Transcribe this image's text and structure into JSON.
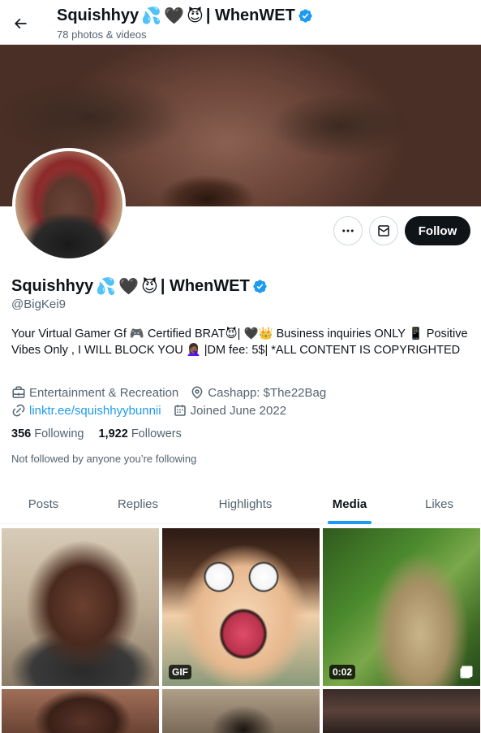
{
  "header": {
    "back_icon": "arrow-left-icon",
    "name_text": "Squishhyy",
    "name_suffix": "| WhenWET",
    "emojis": [
      "💦",
      "🖤",
      "😈"
    ],
    "subtitle": "78 photos & videos"
  },
  "profile": {
    "name_text": "Squishhyy",
    "name_suffix": "| WhenWET",
    "emojis": [
      "💦",
      "🖤",
      "😈"
    ],
    "verified_icon": "verified-badge-icon",
    "handle": "@BigKei9",
    "bio": "Your Virtual Gamer Gf 🎮 Certified BRAT😈| 🖤👑 Business inquiries ONLY 📱 Positive Vibes Only , I WILL BLOCK YOU 🤦🏾‍♀️ |DM fee: 5$| *ALL CONTENT IS COPYRIGHTED",
    "category": "Entertainment & Recreation",
    "location": "Cashapp: $The22Bag",
    "link": "linktr.ee/squishhyybunnii",
    "joined": "Joined June 2022",
    "following_count": "356",
    "following_label": "Following",
    "followers_count": "1,922",
    "followers_label": "Followers",
    "not_followed": "Not followed by anyone you’re following"
  },
  "actions": {
    "more_icon": "more-horizontal-icon",
    "message_icon": "envelope-icon",
    "follow_label": "Follow"
  },
  "tabs": [
    {
      "label": "Posts",
      "active": false
    },
    {
      "label": "Replies",
      "active": false
    },
    {
      "label": "Highlights",
      "active": false
    },
    {
      "label": "Media",
      "active": true
    },
    {
      "label": "Likes",
      "active": false
    }
  ],
  "media": [
    {
      "badge": ""
    },
    {
      "badge": "GIF"
    },
    {
      "badge": "0:02",
      "multi": true
    }
  ],
  "colors": {
    "accent": "#1d9bf0",
    "text_primary": "#0f1419",
    "text_secondary": "#536471",
    "follow_bg": "#0f1419"
  }
}
